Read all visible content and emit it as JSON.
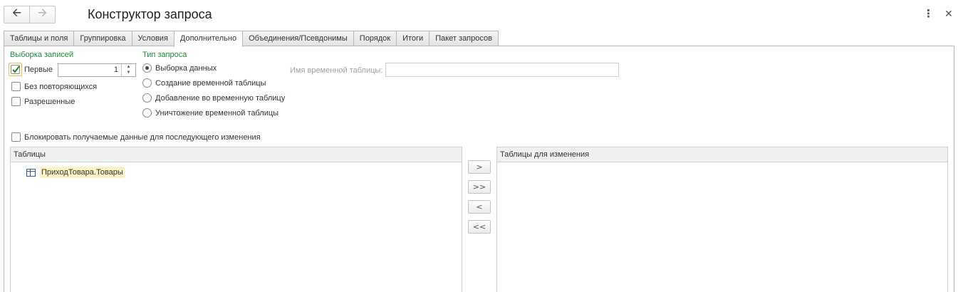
{
  "window": {
    "title": "Конструктор запроса",
    "back_icon": "arrow-left",
    "forward_icon": "arrow-right",
    "more_icon": "vertical-dots",
    "close_icon": "x"
  },
  "tabs": [
    {
      "label": "Таблицы и поля",
      "active": false
    },
    {
      "label": "Группировка",
      "active": false
    },
    {
      "label": "Условия",
      "active": false
    },
    {
      "label": "Дополнительно",
      "active": true
    },
    {
      "label": "Объединения/Псевдонимы",
      "active": false
    },
    {
      "label": "Порядок",
      "active": false
    },
    {
      "label": "Итоги",
      "active": false
    },
    {
      "label": "Пакет запросов",
      "active": false
    }
  ],
  "record_selection": {
    "group_label": "Выборка записей",
    "first": {
      "label": "Первые",
      "checked": true,
      "value": "1"
    },
    "distinct": {
      "label": "Без повторяющихся",
      "checked": false
    },
    "allowed": {
      "label": "Разрешенные",
      "checked": false
    }
  },
  "query_type": {
    "group_label": "Тип запроса",
    "options": [
      {
        "label": "Выборка данных",
        "selected": true
      },
      {
        "label": "Создание временной таблицы",
        "selected": false
      },
      {
        "label": "Добавление во временную таблицу",
        "selected": false
      },
      {
        "label": "Уничтожение временной таблицы",
        "selected": false
      }
    ],
    "temp_table_label": "Имя временной таблицы:",
    "temp_table_value": ""
  },
  "lock": {
    "label": "Блокировать получаемые данные для последующего изменения",
    "checked": false
  },
  "tables_list": {
    "header": "Таблицы",
    "rows": [
      "ПриходТовара.Товары"
    ]
  },
  "tables_for_change": {
    "header": "Таблицы для изменения",
    "rows": []
  },
  "move_buttons": {
    "add": ">",
    "add_all": ">>",
    "remove": "<",
    "remove_all": "<<"
  },
  "colors": {
    "group_label": "#1e8a3c",
    "selection_highlight": "#fdf1c8",
    "focus_border": "#e3c24e"
  }
}
